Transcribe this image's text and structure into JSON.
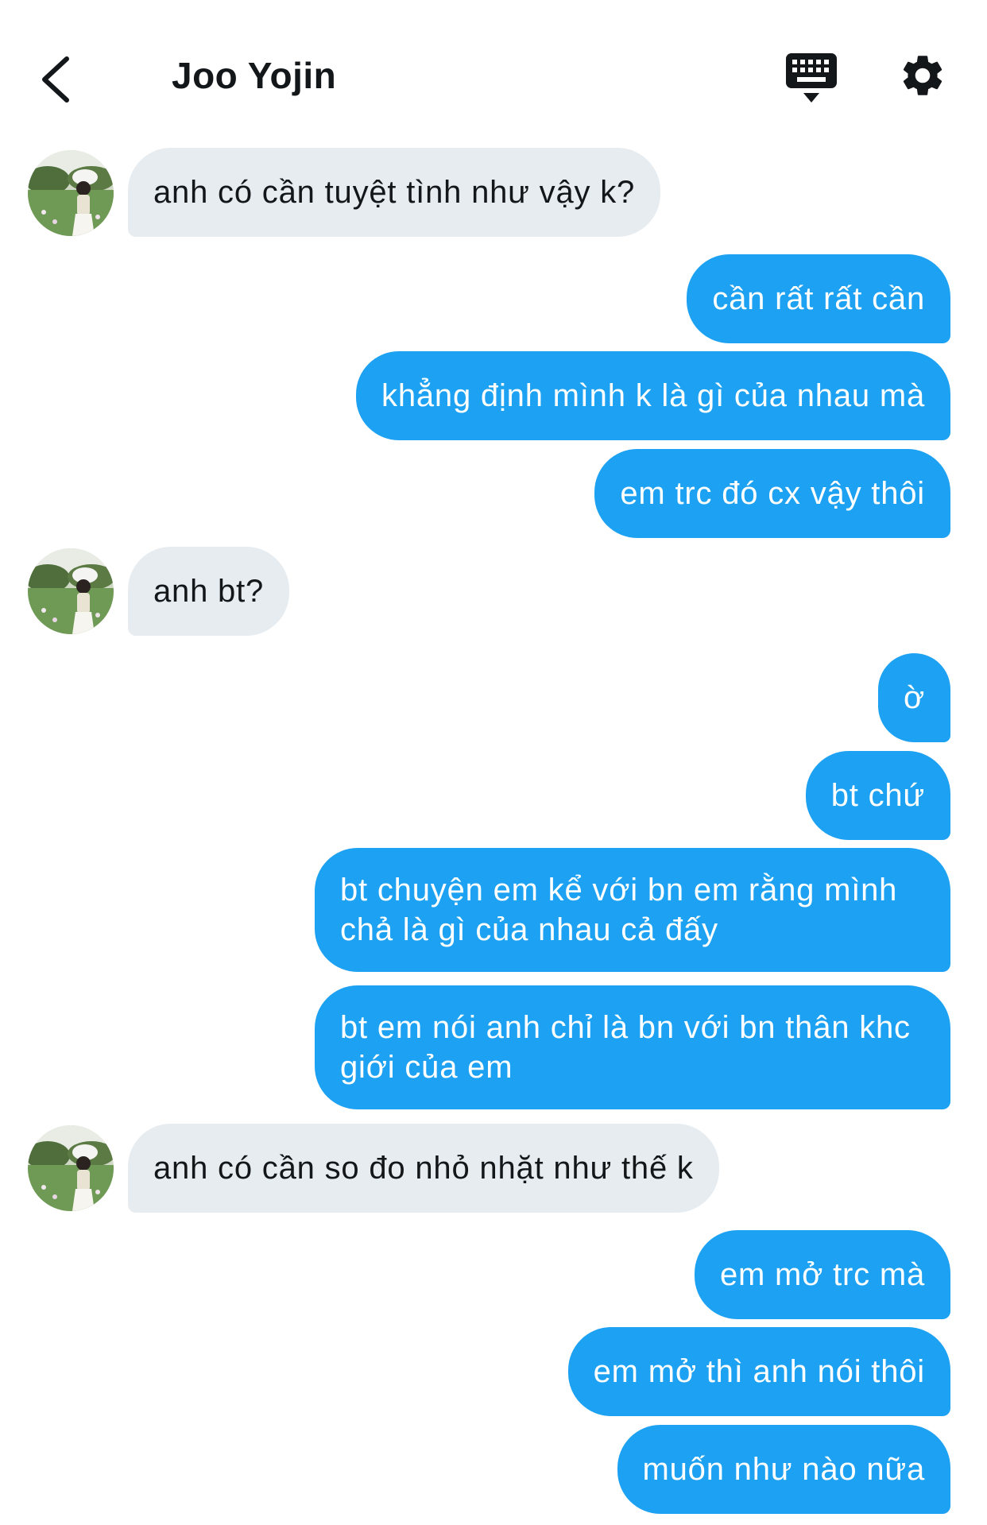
{
  "header": {
    "contact_name": "Joo Yojin",
    "back_icon": "chevron-left-icon",
    "keyboard_icon": "keyboard-icon",
    "settings_icon": "gear-icon"
  },
  "colors": {
    "outgoing_bubble": "#1da1f2",
    "incoming_bubble": "#e6ecf0",
    "text_dark": "#14171a"
  },
  "messages": [
    {
      "from": "them",
      "text": "anh có cần tuyệt tình như vậy k?"
    },
    {
      "from": "me",
      "text": "cần rất rất cần"
    },
    {
      "from": "me",
      "text": "khẳng định mình k là gì của nhau mà"
    },
    {
      "from": "me",
      "text": "em trc đó cx vậy thôi"
    },
    {
      "from": "them",
      "text": "anh bt?"
    },
    {
      "from": "me",
      "text": "ờ"
    },
    {
      "from": "me",
      "text": "bt chứ"
    },
    {
      "from": "me",
      "text": "bt chuyện em kể với bn em rằng mình chả là gì của nhau cả đấy"
    },
    {
      "from": "me",
      "text": "bt em nói anh chỉ là bn với bn thân khc giới của em"
    },
    {
      "from": "them",
      "text": "anh có cần so đo nhỏ nhặt như thế k"
    },
    {
      "from": "me",
      "text": "em mở trc mà"
    },
    {
      "from": "me",
      "text": "em mở thì anh nói thôi"
    },
    {
      "from": "me",
      "text": "muốn như nào nữa"
    }
  ]
}
